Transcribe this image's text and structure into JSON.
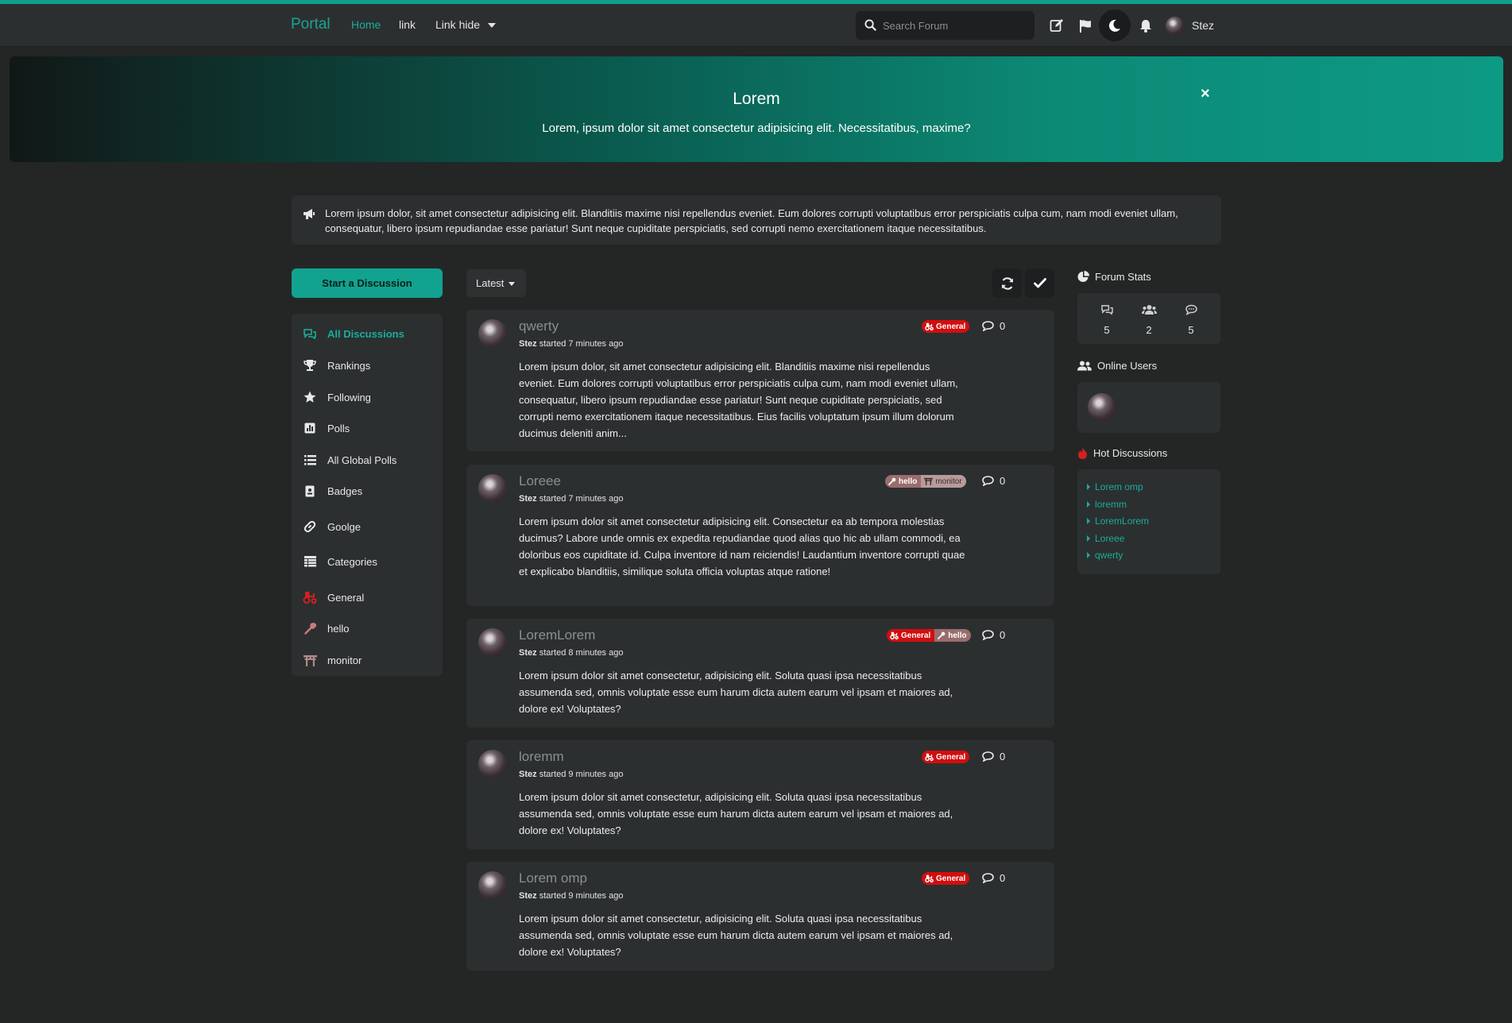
{
  "header": {
    "brand": "Portal",
    "nav": [
      "Home",
      "link",
      "Link hide"
    ],
    "search_placeholder": "Search Forum",
    "user_name": "Stez"
  },
  "hero": {
    "title": "Lorem",
    "subtitle": "Lorem, ipsum dolor sit amet consectetur adipisicing elit. Necessitatibus, maxime?",
    "close": "×"
  },
  "announcement": "Lorem ipsum dolor, sit amet consectetur adipisicing elit. Blanditiis maxime nisi repellendus eveniet. Eum dolores corrupti voluptatibus error perspiciatis culpa cum, nam modi eveniet ullam, consequatur, libero ipsum repudiandae esse pariatur! Sunt neque cupiditate perspiciatis, sed corrupti nemo exercitationem itaque necessitatibus.",
  "start_button": "Start a Discussion",
  "sidebar": {
    "items": [
      {
        "label": "All Discussions",
        "icon": "comments-icon"
      },
      {
        "label": "Rankings",
        "icon": "trophy-icon"
      },
      {
        "label": "Following",
        "icon": "star-icon"
      },
      {
        "label": "Polls",
        "icon": "poll-icon"
      },
      {
        "label": "All Global Polls",
        "icon": "list-icon"
      },
      {
        "label": "Badges",
        "icon": "badge-icon"
      },
      {
        "label": "Goolge",
        "icon": "link-icon"
      },
      {
        "label": "Categories",
        "icon": "table-icon"
      },
      {
        "label": "General",
        "icon": "tractor-icon"
      },
      {
        "label": "hello",
        "icon": "wrench-icon"
      },
      {
        "label": "monitor",
        "icon": "torii-icon"
      }
    ]
  },
  "sort_label": "Latest",
  "discussions": [
    {
      "title": "qwerty",
      "author": "Stez",
      "started": "started 7 minutes ago",
      "tags": [
        "General"
      ],
      "replies": "0",
      "body": "Lorem ipsum dolor, sit amet consectetur adipisicing elit. Blanditiis maxime nisi repellendus eveniet. Eum dolores corrupti voluptatibus error perspiciatis culpa cum, nam modi eveniet ullam, consequatur, libero ipsum repudiandae esse pariatur! Sunt neque cupiditate perspiciatis, sed corrupti nemo exercitationem itaque necessitatibus. Eius facilis voluptatum ipsum illum dolorum ducimus deleniti anim..."
    },
    {
      "title": "Loreee",
      "author": "Stez",
      "started": "started 7 minutes ago",
      "tags": [
        "hello",
        "monitor"
      ],
      "replies": "0",
      "body": "Lorem ipsum dolor sit amet consectetur adipisicing elit. Consectetur ea ab tempora molestias ducimus? Labore unde omnis ex expedita repudiandae quod alias quo hic ab ullam commodi, ea doloribus eos cupiditate id. Culpa inventore id nam reiciendis! Laudantium inventore corrupti quae et explicabo blanditiis, similique soluta officia voluptas atque ratione!"
    },
    {
      "title": "LoremLorem",
      "author": "Stez",
      "started": "started 8 minutes ago",
      "tags": [
        "General",
        "hello"
      ],
      "replies": "0",
      "body": "Lorem ipsum dolor sit amet consectetur, adipisicing elit. Soluta quasi ipsa necessitatibus assumenda sed, omnis voluptate esse eum harum dicta autem earum vel ipsam et maiores ad, dolore ex! Voluptates?"
    },
    {
      "title": "loremm",
      "author": "Stez",
      "started": "started 9 minutes ago",
      "tags": [
        "General"
      ],
      "replies": "0",
      "body": "Lorem ipsum dolor sit amet consectetur, adipisicing elit. Soluta quasi ipsa necessitatibus assumenda sed, omnis voluptate esse eum harum dicta autem earum vel ipsam et maiores ad, dolore ex! Voluptates?"
    },
    {
      "title": "Lorem omp",
      "author": "Stez",
      "started": "started 9 minutes ago",
      "tags": [
        "General"
      ],
      "replies": "0",
      "body": "Lorem ipsum dolor sit amet consectetur, adipisicing elit. Soluta quasi ipsa necessitatibus assumenda sed, omnis voluptate esse eum harum dicta autem earum vel ipsam et maiores ad, dolore ex! Voluptates?"
    }
  ],
  "forum_stats": {
    "title": "Forum Stats",
    "discussions": "5",
    "users": "2",
    "posts": "5"
  },
  "online_users": {
    "title": "Online Users"
  },
  "hot_discussions": {
    "title": "Hot Discussions",
    "items": [
      "Lorem omp",
      "loremm",
      "LoremLorem",
      "Loreee",
      "qwerty"
    ]
  },
  "colors": {
    "accent": "#11a38f",
    "general_tag": "#d20e0e",
    "background": "#242626",
    "panel": "#2c2f30"
  }
}
